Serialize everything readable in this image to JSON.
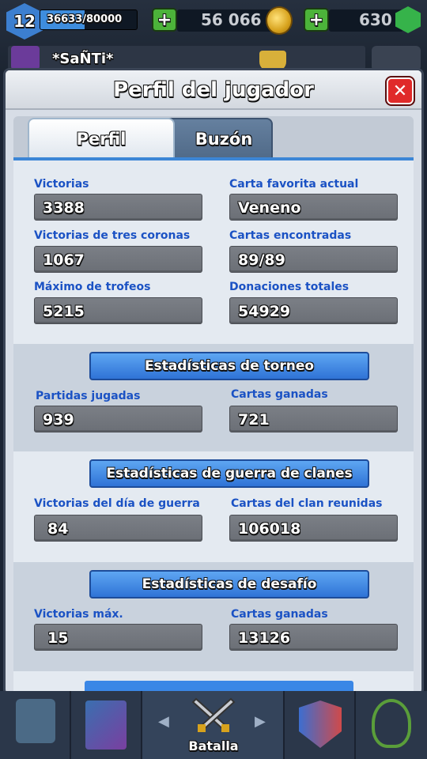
{
  "hud": {
    "level": "12",
    "xp_text": "36633/80000",
    "xp_fraction": 0.458,
    "gold": "56 066",
    "gems": "630",
    "plus_symbol": "+",
    "player_name": "*SaÑTi*",
    "icons": [
      "level-shield-icon",
      "plus-icon",
      "gold-coin-icon",
      "gem-icon",
      "clan-badge-icon",
      "trophy-icon",
      "settings-icon"
    ]
  },
  "modal": {
    "title": "Perfil del jugador",
    "close_symbol": "✕",
    "tabs": [
      {
        "label": "Perfil",
        "active": true
      },
      {
        "label": "Buzón",
        "active": false
      }
    ]
  },
  "profile_stats": {
    "left": [
      {
        "label": "Victorias",
        "value": "3388"
      },
      {
        "label": "Victorias de tres coronas",
        "value": "1067"
      },
      {
        "label": "Máximo de trofeos",
        "value": "5215"
      }
    ],
    "right": [
      {
        "label": "Carta favorita actual",
        "value": "Veneno"
      },
      {
        "label": "Cartas encontradas",
        "value": "89/89"
      },
      {
        "label": "Donaciones totales",
        "value": "54929"
      }
    ]
  },
  "tournament": {
    "title": "Estadísticas de torneo",
    "left": {
      "label": "Partidas jugadas",
      "value": "939"
    },
    "right": {
      "label": "Cartas ganadas",
      "value": "721"
    }
  },
  "clan_war": {
    "title": "Estadísticas de guerra de clanes",
    "left": {
      "label": "Victorias del día de guerra",
      "value": "84"
    },
    "right": {
      "label": "Cartas del clan reunidas",
      "value": "106018"
    }
  },
  "challenge": {
    "title": "Estadísticas de desafío",
    "left": {
      "label": "Victorias máx.",
      "value": "15"
    },
    "right": {
      "label": "Cartas ganadas",
      "value": "13126"
    }
  },
  "bottom_nav": {
    "active_label": "Batalla",
    "arrow_left": "◀",
    "arrow_right": "▶",
    "items": [
      "shop-chest-icon",
      "cards-icon",
      "battle-swords-icon",
      "clan-icon",
      "tournament-sword-icon"
    ]
  },
  "colors": {
    "label_blue": "#1b52c4",
    "ribbon_blue": "#3a87e6",
    "value_box_gray": "#73777e",
    "close_red": "#e02a2a",
    "plus_green": "#4cb33a"
  }
}
